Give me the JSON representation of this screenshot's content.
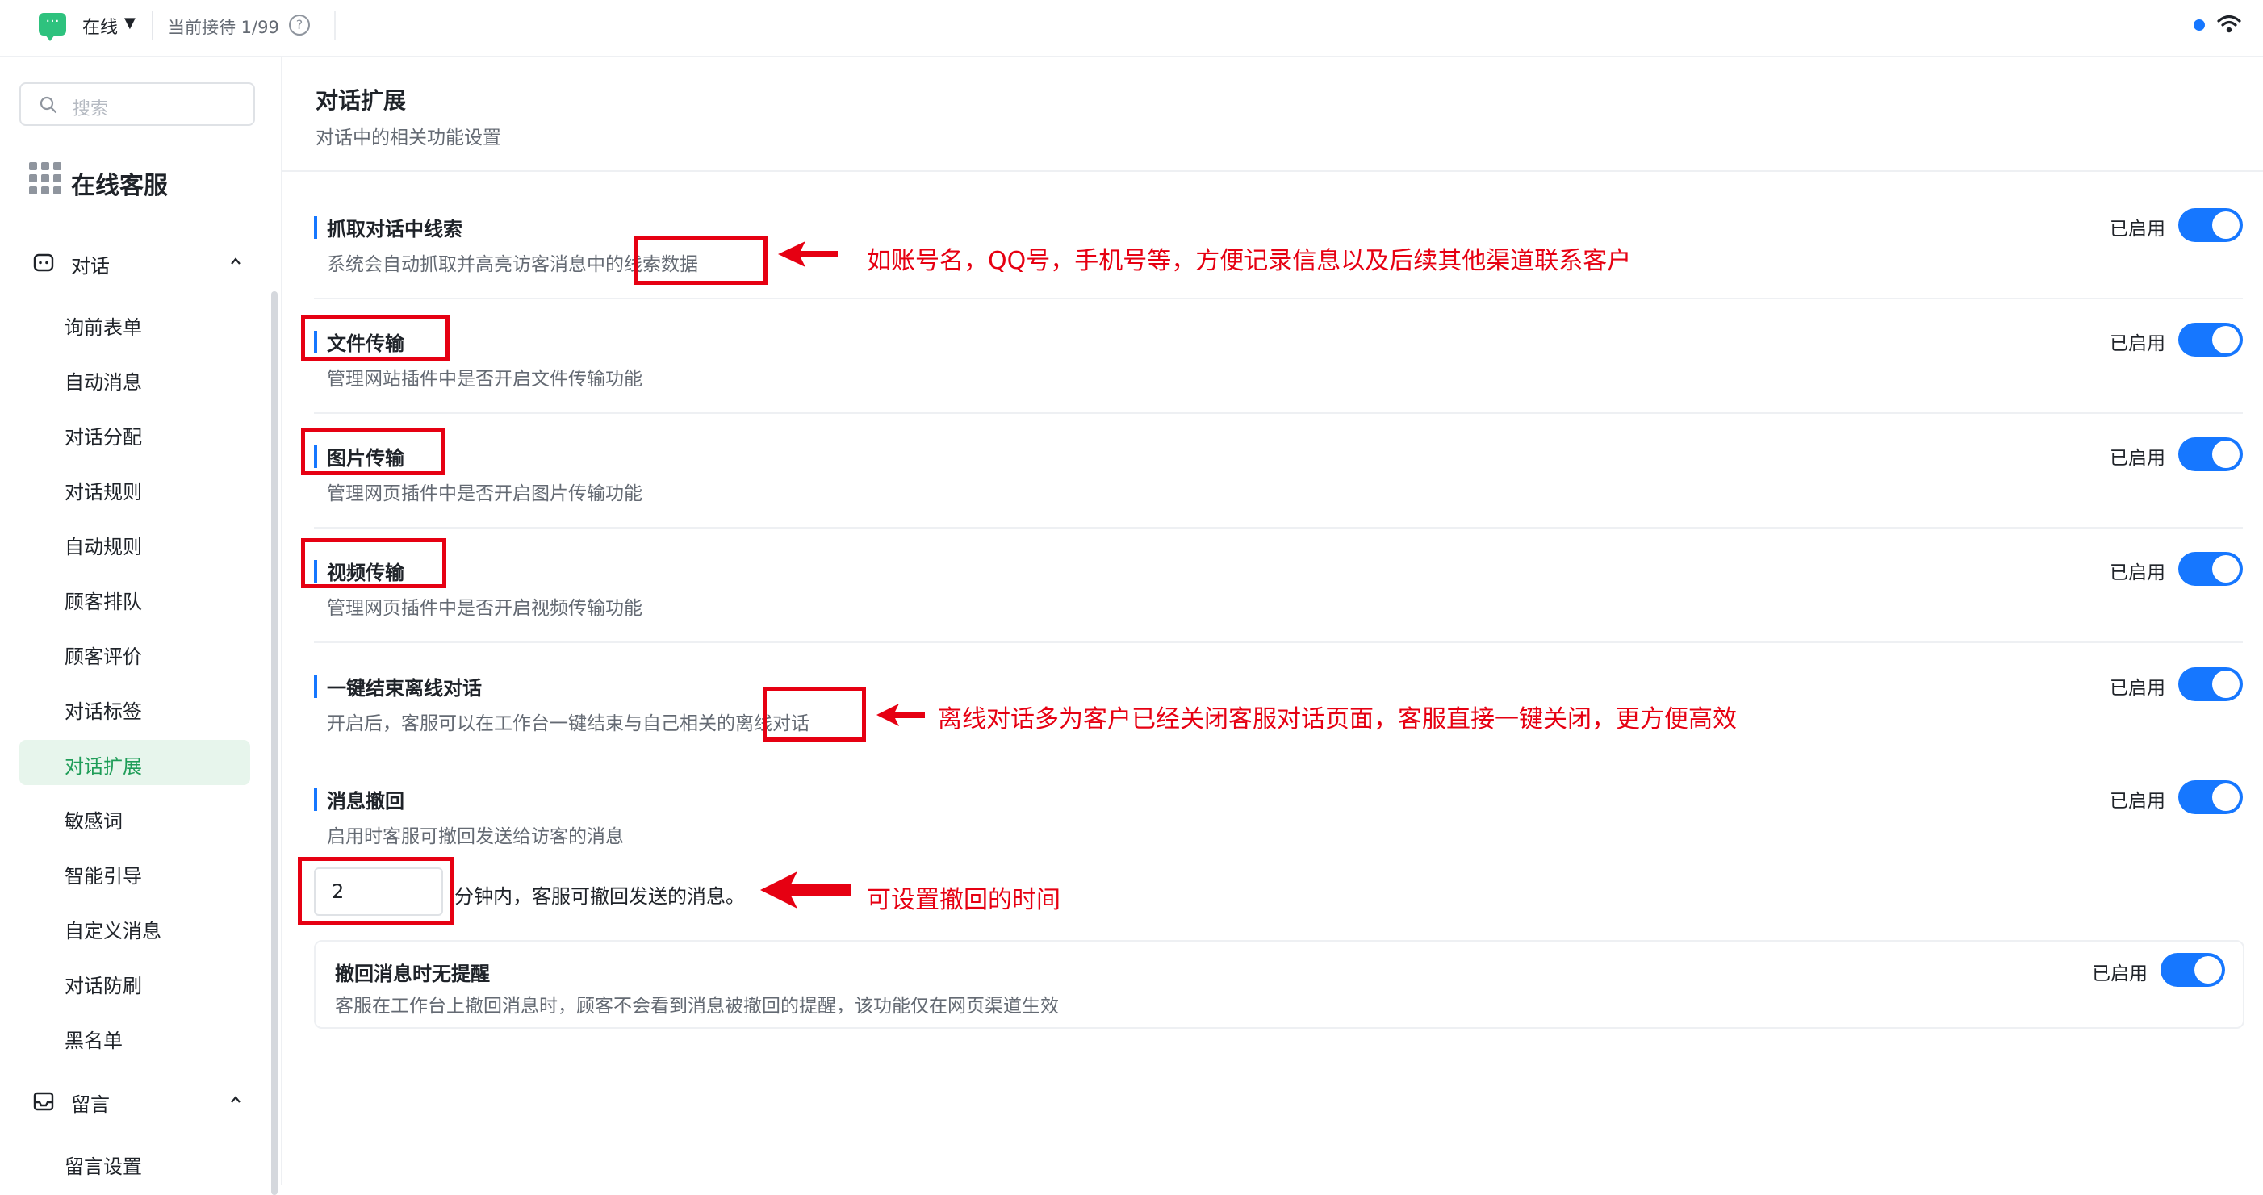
{
  "topbar": {
    "status_label": "在线",
    "queue_label": "当前接待 1/99",
    "help_glyph": "?",
    "icons": [
      "chat-status-icon",
      "chevron-down-icon",
      "help-icon",
      "online-dot",
      "wifi-icon"
    ]
  },
  "sidebar": {
    "search_placeholder": "搜索",
    "app_title": "在线客服",
    "group_dialog": "对话",
    "dialog_items": [
      "询前表单",
      "自动消息",
      "对话分配",
      "对话规则",
      "自动规则",
      "顾客排队",
      "顾客评价",
      "对话标签",
      "对话扩展",
      "敏感词",
      "智能引导",
      "自定义消息",
      "对话防刷",
      "黑名单"
    ],
    "active_item": "对话扩展",
    "group_message": "留言",
    "message_items": [
      "留言设置"
    ]
  },
  "main": {
    "title": "对话扩展",
    "subtitle": "对话中的相关功能设置",
    "settings": [
      {
        "title": "抓取对话中线索",
        "desc": "系统会自动抓取并高亮访客消息中的线索数据",
        "status": "已启用",
        "enabled": true
      },
      {
        "title": "文件传输",
        "desc": "管理网站插件中是否开启文件传输功能",
        "status": "已启用",
        "enabled": true
      },
      {
        "title": "图片传输",
        "desc": "管理网页插件中是否开启图片传输功能",
        "status": "已启用",
        "enabled": true
      },
      {
        "title": "视频传输",
        "desc": "管理网页插件中是否开启视频传输功能",
        "status": "已启用",
        "enabled": true
      },
      {
        "title": "一键结束离线对话",
        "desc": "开启后，客服可以在工作台一键结束与自己相关的离线对话",
        "status": "已启用",
        "enabled": true
      },
      {
        "title": "消息撤回",
        "desc": "启用时客服可撤回发送给访客的消息",
        "status": "已启用",
        "enabled": true
      }
    ],
    "recall_minutes": "2",
    "recall_suffix": "分钟内，客服可撤回发送的消息。",
    "sub_setting": {
      "title": "撤回消息时无提醒",
      "desc": "客服在工作台上撤回消息时，顾客不会看到消息被撤回的提醒，该功能仅在网页渠道生效",
      "status": "已启用",
      "enabled": true
    }
  },
  "annotations": {
    "clue_note": "如账号名，QQ号，手机号等，方便记录信息以及后续其他渠道联系客户",
    "offline_note": "离线对话多为客户已经关闭客服对话页面，客服直接一键关闭，更方便高效",
    "recall_note": "可设置撤回的时间",
    "color": "#e60012"
  },
  "colors": {
    "accent": "#1677ff",
    "brand_green": "#2ec27e",
    "active_nav_bg": "#e7f5ec",
    "active_nav_text": "#1f9d58"
  }
}
